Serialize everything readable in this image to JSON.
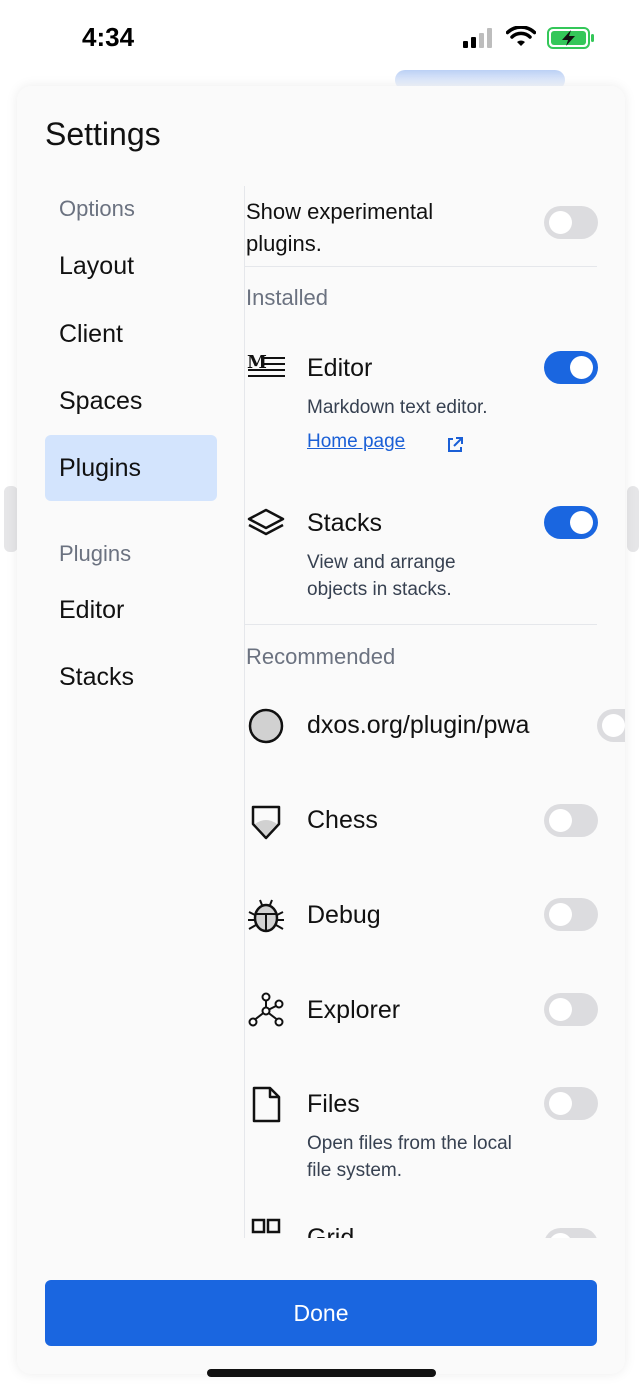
{
  "status": {
    "time": "4:34"
  },
  "dialog": {
    "title": "Settings",
    "nav": {
      "options_header": "Options",
      "options": [
        "Layout",
        "Client",
        "Spaces",
        "Plugins"
      ],
      "selected": "Plugins",
      "plugins_header": "Plugins",
      "plugins": [
        "Editor",
        "Stacks"
      ]
    },
    "experimental": {
      "label": "Show experimental plugins.",
      "enabled": false
    },
    "installed": {
      "title": "Installed",
      "items": [
        {
          "name": "Editor",
          "description": "Markdown text editor.",
          "link": "Home page",
          "icon": "markdown-icon",
          "enabled": true
        },
        {
          "name": "Stacks",
          "description": "View and arrange objects in stacks.",
          "icon": "layers-icon",
          "enabled": true
        }
      ]
    },
    "recommended": {
      "title": "Recommended",
      "items": [
        {
          "name": "dxos.org/plugin/pwa",
          "icon": "circle-icon",
          "enabled": false
        },
        {
          "name": "Chess",
          "icon": "shield-icon",
          "enabled": false
        },
        {
          "name": "Debug",
          "icon": "bug-icon",
          "enabled": false
        },
        {
          "name": "Explorer",
          "icon": "graph-icon",
          "enabled": false
        },
        {
          "name": "Files",
          "description": "Open files from the local file system.",
          "icon": "file-icon",
          "enabled": false
        },
        {
          "name": "Grid",
          "icon": "grid-icon",
          "enabled": false
        }
      ]
    },
    "done_label": "Done"
  },
  "colors": {
    "accent": "#1a66e0",
    "selected_bg": "#d3e4fd",
    "muted_text": "#6b7280"
  }
}
